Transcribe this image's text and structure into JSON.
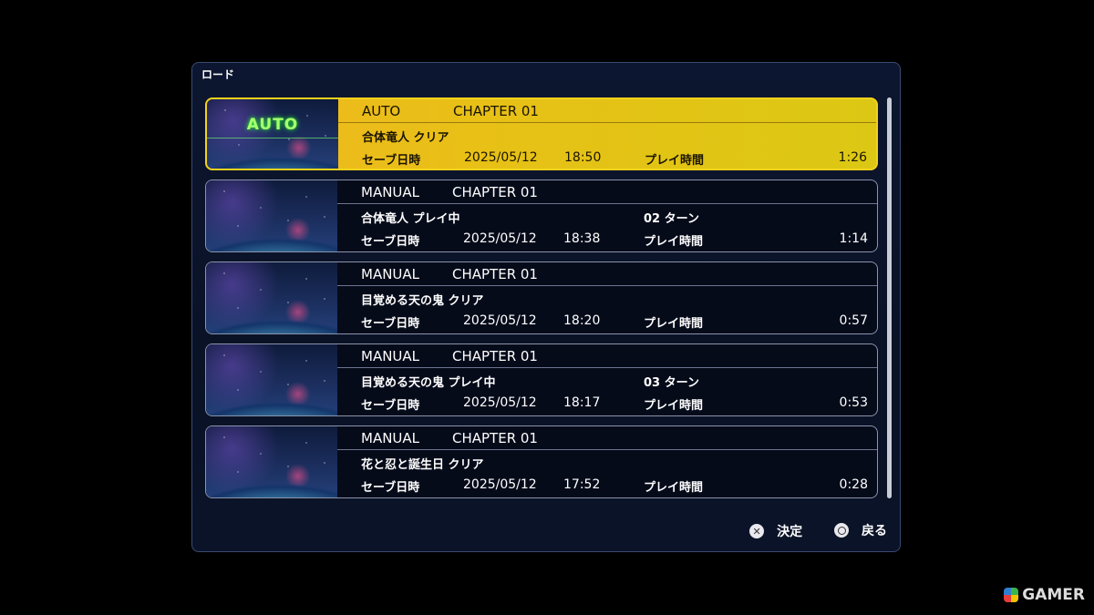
{
  "window": {
    "title": "ロード"
  },
  "save_label": "セーブ日時",
  "play_label": "プレイ時間",
  "auto_badge": "AUTO",
  "slots": [
    {
      "type": "AUTO",
      "chapter": "CHAPTER 01",
      "stage": "合体竜人 クリア",
      "turn": "",
      "date": "2025/05/12",
      "time": "18:50",
      "play_time": "1:26",
      "selected": true
    },
    {
      "type": "MANUAL",
      "chapter": "CHAPTER 01",
      "stage": "合体竜人 プレイ中",
      "turn": "02 ターン",
      "date": "2025/05/12",
      "time": "18:38",
      "play_time": "1:14",
      "selected": false
    },
    {
      "type": "MANUAL",
      "chapter": "CHAPTER 01",
      "stage": "目覚める天の鬼 クリア",
      "turn": "",
      "date": "2025/05/12",
      "time": "18:20",
      "play_time": "0:57",
      "selected": false
    },
    {
      "type": "MANUAL",
      "chapter": "CHAPTER 01",
      "stage": "目覚める天の鬼 プレイ中",
      "turn": "03 ターン",
      "date": "2025/05/12",
      "time": "18:17",
      "play_time": "0:53",
      "selected": false
    },
    {
      "type": "MANUAL",
      "chapter": "CHAPTER 01",
      "stage": "花と忍と誕生日 クリア",
      "turn": "",
      "date": "2025/05/12",
      "time": "17:52",
      "play_time": "0:28",
      "selected": false
    }
  ],
  "footer": {
    "confirm_icon": "cross-button-icon",
    "confirm_label": "決定",
    "back_icon": "circle-button-icon",
    "back_label": "戻る"
  },
  "watermark": "GAMER",
  "colors": {
    "selected": "#e8c016",
    "background": "#000000",
    "panel": "#0c1530"
  }
}
